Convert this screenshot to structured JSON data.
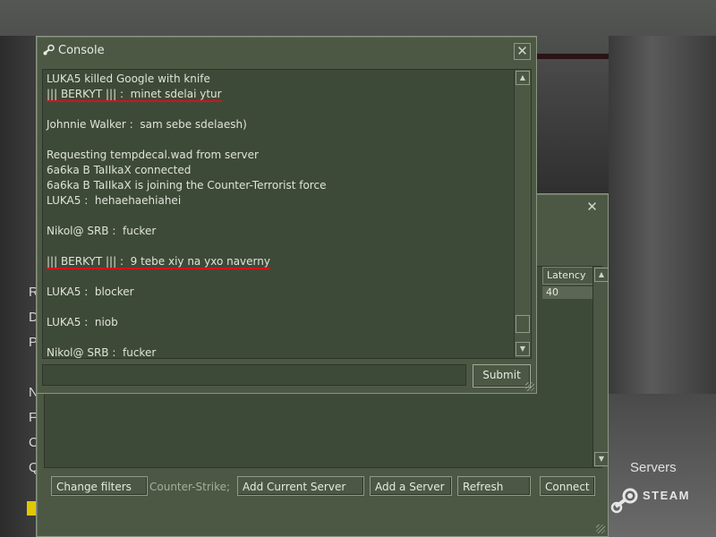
{
  "background": {
    "menu_letters": [
      "R",
      "D",
      "P",
      "N",
      "F",
      "C",
      "Q"
    ],
    "servers_label": "Servers",
    "steam_text": "STEAM"
  },
  "server_browser": {
    "latency_header": "Latency",
    "latency_value": "40",
    "buttons": {
      "change_filters": "Change filters",
      "add_current": "Add Current Server",
      "add_server": "Add a Server",
      "refresh": "Refresh",
      "connect": "Connect"
    },
    "game_filter": "Counter-Strike;"
  },
  "console": {
    "title": "Console",
    "close_glyph": "✕",
    "lines": [
      "LUKA5 killed Google with knife",
      "||| BERKYT ||| :  minet sdelai ytur",
      "",
      "Johnnie Walker :  sam sebe sdelaesh)",
      "",
      "Requesting tempdecal.wad from server",
      "6a6ka B TaIIkaX connected",
      "6a6ka B TaIIkaX is joining the Counter-Terrorist force",
      "LUKA5 :  hehaehaehiahei",
      "",
      "Nikol@ SRB :  fucker",
      "",
      "||| BERKYT ||| :  9 tebe xiy na yxo naverny",
      "",
      "LUKA5 :  blocker",
      "",
      "LUKA5 :  niob",
      "",
      "Nikol@ SRB :  fucker"
    ],
    "input_value": "",
    "submit_label": "Submit"
  }
}
